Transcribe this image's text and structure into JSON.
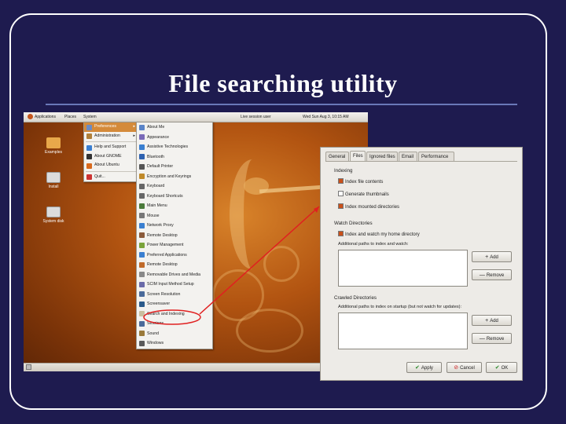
{
  "slide": {
    "title": "File searching utility"
  },
  "topbar": {
    "applications": "Applications",
    "places": "Places",
    "system": "System",
    "session": "Live session user",
    "clock": "Wed Sun Aug 3, 10:15 AM"
  },
  "desktop_icons": [
    "Examples",
    "Install",
    "System disk"
  ],
  "system_menu": {
    "items": [
      {
        "label": "Preferences",
        "icon_color": "#6b8bc4",
        "submenu": true
      },
      {
        "label": "Administration",
        "icon_color": "#b0803a",
        "submenu": true
      },
      {
        "label": "Help and Support",
        "icon_color": "#3a7fd0"
      },
      {
        "label": "About GNOME",
        "icon_color": "#333333"
      },
      {
        "label": "About Ubuntu",
        "icon_color": "#d86a1e"
      },
      {
        "label": "Quit...",
        "icon_color": "#cc3333"
      }
    ]
  },
  "prefs_menu": {
    "items": [
      "About Me",
      "Appearance",
      "Assistive Technologies",
      "Bluetooth",
      "Default Printer",
      "Encryption and Keyrings",
      "Keyboard",
      "Keyboard Shortcuts",
      "Main Menu",
      "Mouse",
      "Network Proxy",
      "Remote Desktop",
      "Power Management",
      "Preferred Applications",
      "Remote Desktop",
      "Removable Drives and Media",
      "SCIM Input Method Setup",
      "Screen Resolution",
      "Screensaver",
      "Search and Indexing",
      "Sessions",
      "Sound",
      "Windows"
    ],
    "highlight_index": 19
  },
  "dialog": {
    "tabs": [
      "General",
      "Files",
      "Ignored files",
      "Email",
      "Performance"
    ],
    "active_tab": 1,
    "indexing": {
      "title": "Indexing",
      "options": [
        {
          "label": "Index file contents",
          "checked": true
        },
        {
          "label": "Generate thumbnails",
          "checked": false
        },
        {
          "label": "Index mounted directories",
          "checked": true
        }
      ]
    },
    "watch": {
      "title": "Watch Directories",
      "option": {
        "label": "Index and watch my home directory",
        "checked": true
      },
      "additional": "Additional paths to index and watch:",
      "add": "Add",
      "remove": "Remove"
    },
    "crawled": {
      "title": "Crawled Directories",
      "additional": "Additional paths to index on startup (but not watch for updates):",
      "add": "Add",
      "remove": "Remove"
    },
    "footer": {
      "apply": "Apply",
      "cancel": "Cancel",
      "ok": "OK"
    }
  },
  "colors": {
    "background": "#1e1b4f",
    "annotation": "#e02020",
    "menu_highlight": "#d48a3a"
  }
}
